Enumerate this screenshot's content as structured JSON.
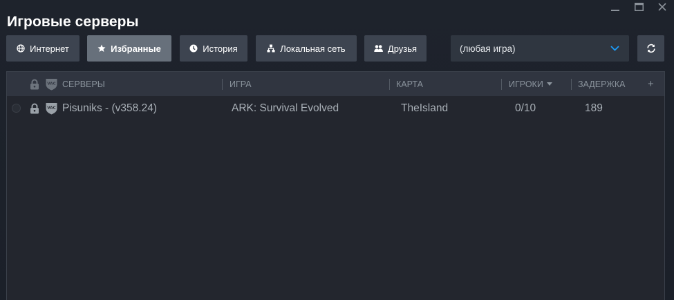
{
  "window": {
    "title": "Игровые серверы",
    "controls": [
      "minimize-icon",
      "maximize-icon",
      "close-icon"
    ]
  },
  "tabs": [
    {
      "label": "Интернет",
      "icon": "globe-icon",
      "active": false
    },
    {
      "label": "Избранные",
      "icon": "star-icon",
      "active": true
    },
    {
      "label": "История",
      "icon": "clock-icon",
      "active": false
    },
    {
      "label": "Локальная сеть",
      "icon": "lan-icon",
      "active": false
    },
    {
      "label": "Друзья",
      "icon": "friends-icon",
      "active": false
    }
  ],
  "game_filter": {
    "value": "(любая игра)",
    "icon": "chevron-down-icon"
  },
  "refresh": {
    "icon": "refresh-icon"
  },
  "columns": {
    "servers": "СЕРВЕРЫ",
    "game": "ИГРА",
    "map": "КАРТА",
    "players": "ИГРОКИ",
    "latency": "ЗАДЕРЖКА",
    "add": "+"
  },
  "servers": [
    {
      "name": "Pisuniks - (v358.24)",
      "game": "ARK: Survival Evolved",
      "map": "TheIsland",
      "players": "0/10",
      "latency": "189",
      "locked": true,
      "vac": true
    }
  ],
  "colors": {
    "background": "#1b2029",
    "tab": "#3d4450",
    "tab_active": "#67707b",
    "accent": "#1a9fff",
    "list_bg": "#23262e",
    "header_bg": "#303540"
  }
}
